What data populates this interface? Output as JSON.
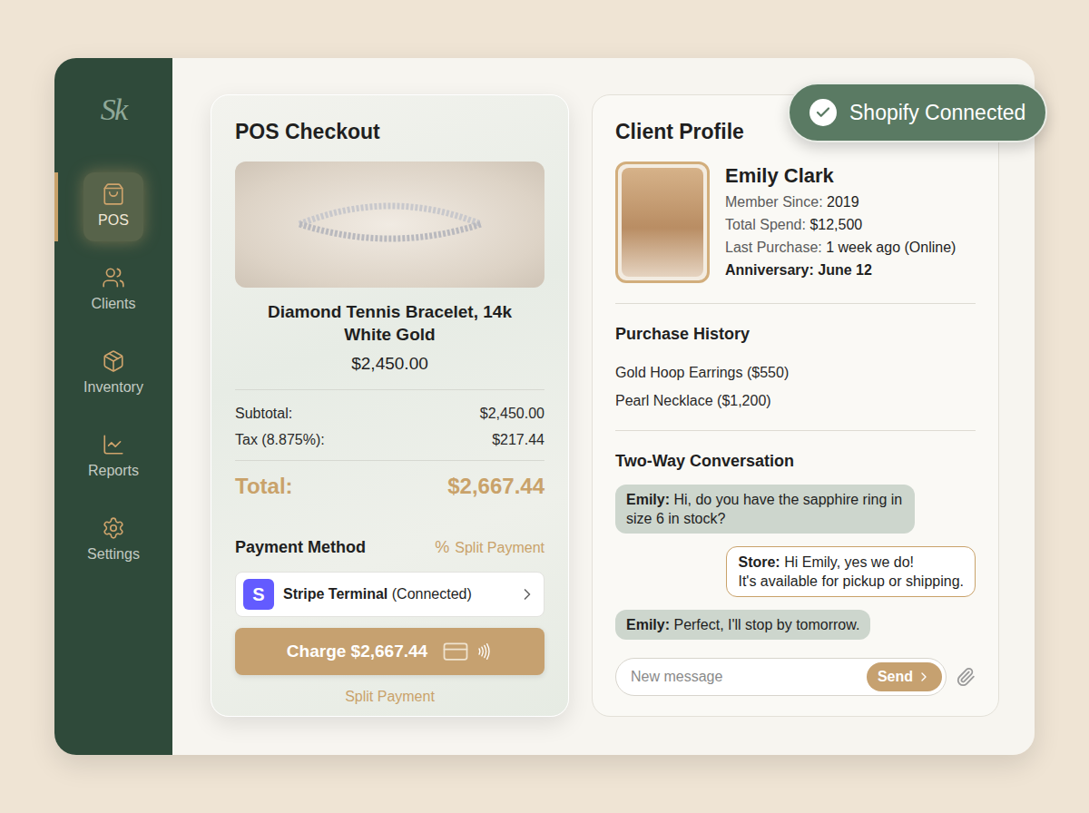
{
  "sidebar": {
    "logo": "Sk",
    "items": [
      {
        "label": "POS",
        "selected": true
      },
      {
        "label": "Clients",
        "selected": false
      },
      {
        "label": "Inventory",
        "selected": false
      },
      {
        "label": "Reports",
        "selected": false
      },
      {
        "label": "Settings",
        "selected": false
      }
    ]
  },
  "badge": {
    "label": "Shopify Connected"
  },
  "pos": {
    "title": "POS Checkout",
    "product": {
      "name": "Diamond Tennis Bracelet, 14k White Gold",
      "price": "$2,450.00"
    },
    "lines": [
      {
        "label": "Subtotal:",
        "value": "$2,450.00"
      },
      {
        "label": "Tax (8.875%):",
        "value": "$217.44"
      }
    ],
    "total": {
      "label": "Total:",
      "value": "$2,667.44"
    },
    "payment": {
      "title": "Payment Method",
      "split_icon": "%",
      "split_link": "Split Payment",
      "provider_logo": "S",
      "provider": "Stripe Terminal",
      "provider_status": "(Connected)",
      "charge_button": "Charge $2,667.44",
      "split_button": "Split Payment"
    }
  },
  "client": {
    "title": "Client Profile",
    "name": "Emily Clark",
    "details": [
      {
        "label": "Member Since:",
        "value": "2019",
        "bold": false
      },
      {
        "label": "Total Spend:",
        "value": "$12,500",
        "bold": false
      },
      {
        "label": "Last Purchase:",
        "value": "1 week ago (Online)",
        "bold": false
      },
      {
        "label": "Anniversary:",
        "value": "June 12",
        "bold": true
      }
    ],
    "history_title": "Purchase History",
    "history": [
      "Gold Hoop Earrings ($550)",
      "Pearl Necklace ($1,200)"
    ],
    "conversation_title": "Two-Way Conversation",
    "messages": [
      {
        "sender": "Emily:",
        "text": "Hi, do you have the sapphire ring in size 6 in stock?",
        "from_store": false
      },
      {
        "sender": "Store:",
        "text": "Hi Emily, yes we do!\nIt's available for pickup or shipping.",
        "from_store": true
      },
      {
        "sender": "Emily:",
        "text": "Perfect, I'll stop by tomorrow.",
        "from_store": false
      }
    ],
    "input": {
      "placeholder": "New message",
      "send": "Send"
    }
  }
}
